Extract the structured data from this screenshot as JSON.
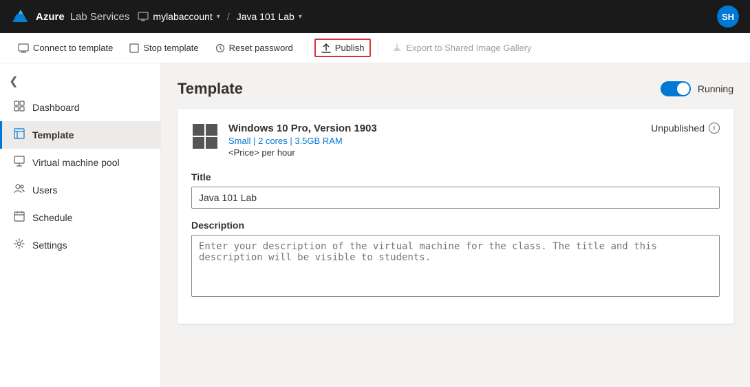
{
  "topbar": {
    "logo_icon_label": "azure-logo",
    "brand_azure": "Azure",
    "brand_service": "Lab Services",
    "breadcrumb": {
      "account_icon": "computer-icon",
      "account_name": "mylabaccount",
      "separator": "/",
      "lab_name": "Java 101 Lab"
    },
    "avatar_initials": "SH"
  },
  "toolbar": {
    "connect_label": "Connect to template",
    "stop_label": "Stop template",
    "reset_label": "Reset password",
    "publish_label": "Publish",
    "export_label": "Export to Shared Image Gallery"
  },
  "sidebar": {
    "collapse_icon": "◁",
    "items": [
      {
        "id": "dashboard",
        "label": "Dashboard",
        "icon": "⊞"
      },
      {
        "id": "template",
        "label": "Template",
        "icon": "⊿",
        "active": true
      },
      {
        "id": "virtual-machine-pool",
        "label": "Virtual machine pool",
        "icon": "▣"
      },
      {
        "id": "users",
        "label": "Users",
        "icon": "⚇"
      },
      {
        "id": "schedule",
        "label": "Schedule",
        "icon": "⬜"
      },
      {
        "id": "settings",
        "label": "Settings",
        "icon": "⚙"
      }
    ]
  },
  "main": {
    "title": "Template",
    "toggle_status": "Running",
    "card": {
      "vm_name": "Windows 10 Pro, Version 1903",
      "vm_spec": "Small | 2 cores | 3.5GB RAM",
      "vm_price": "<Price> per hour",
      "status": "Unpublished",
      "title_label": "Title",
      "title_value": "Java 101 Lab",
      "description_label": "Description",
      "description_placeholder": "Enter your description of the virtual machine for the class. The title and this description will be visible to students."
    }
  }
}
